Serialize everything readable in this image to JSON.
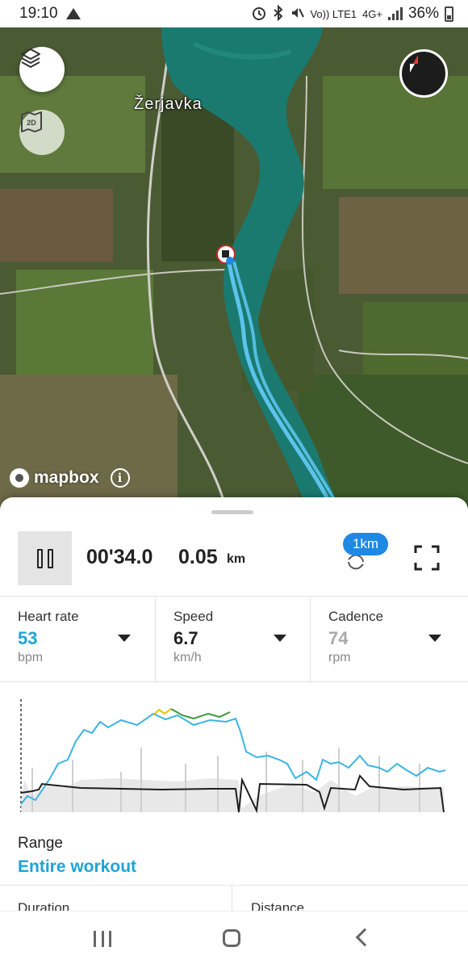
{
  "status_bar": {
    "time": "19:10",
    "volte": "Vo)) LTE1",
    "network": "4G+",
    "battery": "36%"
  },
  "map": {
    "town_label": "Žerjavka",
    "attribution": "mapbox",
    "icons": [
      "layers-icon",
      "map-2d-icon",
      "compass-icon",
      "info-icon"
    ]
  },
  "summary": {
    "duration": "00'34.0",
    "distance": "0.05",
    "distance_unit": "km",
    "lap_badge": "1km"
  },
  "metrics": [
    {
      "label": "Heart rate",
      "value": "53",
      "unit": "bpm",
      "color": "#1fa3d6"
    },
    {
      "label": "Speed",
      "value": "6.7",
      "unit": "km/h",
      "color": "#222222"
    },
    {
      "label": "Cadence",
      "value": "74",
      "unit": "rpm",
      "color": "#a9a9a9"
    }
  ],
  "graph": {
    "heart_rate_color": "#3ab5e3",
    "speed_color": "#1e1e1e",
    "cadence_color": "#c9c9c9"
  },
  "range": {
    "label": "Range",
    "value": "Entire workout"
  },
  "bottom": {
    "left_label": "Duration",
    "right_label": "Distance"
  },
  "colors": {
    "accent": "#1fa3d6",
    "lap_badge": "#1e88e5",
    "route": "#5cc4ec",
    "water": "#1b7a70"
  }
}
